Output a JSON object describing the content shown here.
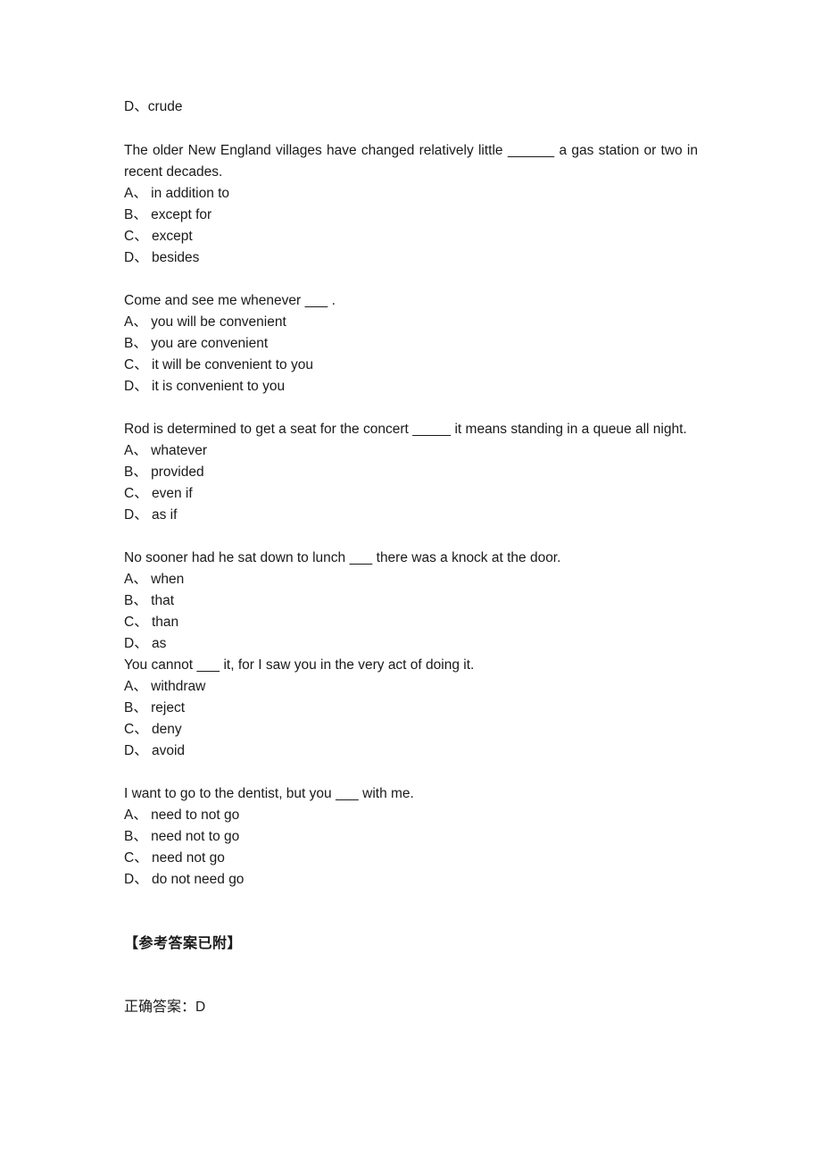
{
  "document": {
    "page_background": "#ffffff",
    "text_color": "#1a1a1a",
    "orphan_option": "D、crude",
    "questions": [
      {
        "stem": "The older New England villages have changed relatively little __________ a gas station or two in recent decades.",
        "options": [
          "A、 in addition to",
          "B、 except for",
          "C、 except",
          "D、 besides"
        ]
      },
      {
        "stem": "Come and see me whenever ______ .",
        "options": [
          "A、 you will be convenient",
          "B、 you are convenient",
          "C、 it will be convenient to you",
          "D、 it is convenient to you"
        ]
      },
      {
        "stem": "Rod is determined to get a seat for the concert __________ it means standing in a queue all night.",
        "options": [
          "A、 whatever",
          "B、 provided",
          "C、 even if",
          "D、 as if"
        ]
      },
      {
        "stem": "No sooner had he sat down to lunch ______ there was a knock at the door.",
        "options": [
          "A、 when",
          "B、 that",
          "C、 than",
          "D、 as"
        ]
      },
      {
        "stem": "You cannot ______ it, for I saw you in the very act of doing it.",
        "options": [
          "A、 withdraw",
          "B、 reject",
          "C、 deny",
          "D、 avoid"
        ]
      },
      {
        "stem": "I want to go to the dentist, but you ______ with me.",
        "options": [
          "A、 need to not go",
          "B、 need not to go",
          "C、 need not go",
          "D、 do not need go"
        ]
      }
    ],
    "answer_section": {
      "heading": "【参考答案已附】",
      "answer_label": "正确答案：",
      "answer_value": "D"
    }
  }
}
